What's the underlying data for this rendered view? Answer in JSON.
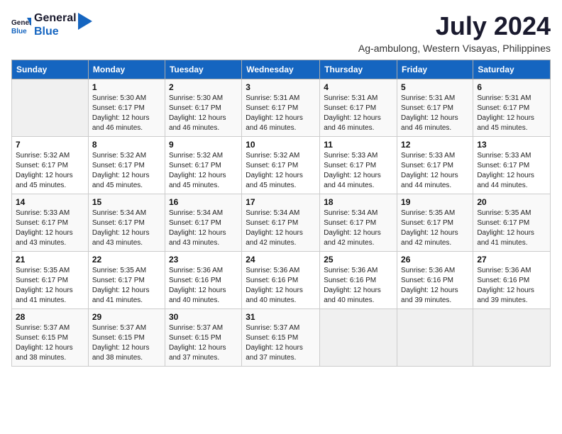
{
  "header": {
    "logo_line1": "General",
    "logo_line2": "Blue",
    "month": "July 2024",
    "location": "Ag-ambulong, Western Visayas, Philippines"
  },
  "days_of_week": [
    "Sunday",
    "Monday",
    "Tuesday",
    "Wednesday",
    "Thursday",
    "Friday",
    "Saturday"
  ],
  "weeks": [
    [
      {
        "day": "",
        "sunrise": "",
        "sunset": "",
        "daylight": ""
      },
      {
        "day": "1",
        "sunrise": "Sunrise: 5:30 AM",
        "sunset": "Sunset: 6:17 PM",
        "daylight": "Daylight: 12 hours and 46 minutes."
      },
      {
        "day": "2",
        "sunrise": "Sunrise: 5:30 AM",
        "sunset": "Sunset: 6:17 PM",
        "daylight": "Daylight: 12 hours and 46 minutes."
      },
      {
        "day": "3",
        "sunrise": "Sunrise: 5:31 AM",
        "sunset": "Sunset: 6:17 PM",
        "daylight": "Daylight: 12 hours and 46 minutes."
      },
      {
        "day": "4",
        "sunrise": "Sunrise: 5:31 AM",
        "sunset": "Sunset: 6:17 PM",
        "daylight": "Daylight: 12 hours and 46 minutes."
      },
      {
        "day": "5",
        "sunrise": "Sunrise: 5:31 AM",
        "sunset": "Sunset: 6:17 PM",
        "daylight": "Daylight: 12 hours and 46 minutes."
      },
      {
        "day": "6",
        "sunrise": "Sunrise: 5:31 AM",
        "sunset": "Sunset: 6:17 PM",
        "daylight": "Daylight: 12 hours and 45 minutes."
      }
    ],
    [
      {
        "day": "7",
        "sunrise": "Sunrise: 5:32 AM",
        "sunset": "Sunset: 6:17 PM",
        "daylight": "Daylight: 12 hours and 45 minutes."
      },
      {
        "day": "8",
        "sunrise": "Sunrise: 5:32 AM",
        "sunset": "Sunset: 6:17 PM",
        "daylight": "Daylight: 12 hours and 45 minutes."
      },
      {
        "day": "9",
        "sunrise": "Sunrise: 5:32 AM",
        "sunset": "Sunset: 6:17 PM",
        "daylight": "Daylight: 12 hours and 45 minutes."
      },
      {
        "day": "10",
        "sunrise": "Sunrise: 5:32 AM",
        "sunset": "Sunset: 6:17 PM",
        "daylight": "Daylight: 12 hours and 45 minutes."
      },
      {
        "day": "11",
        "sunrise": "Sunrise: 5:33 AM",
        "sunset": "Sunset: 6:17 PM",
        "daylight": "Daylight: 12 hours and 44 minutes."
      },
      {
        "day": "12",
        "sunrise": "Sunrise: 5:33 AM",
        "sunset": "Sunset: 6:17 PM",
        "daylight": "Daylight: 12 hours and 44 minutes."
      },
      {
        "day": "13",
        "sunrise": "Sunrise: 5:33 AM",
        "sunset": "Sunset: 6:17 PM",
        "daylight": "Daylight: 12 hours and 44 minutes."
      }
    ],
    [
      {
        "day": "14",
        "sunrise": "Sunrise: 5:33 AM",
        "sunset": "Sunset: 6:17 PM",
        "daylight": "Daylight: 12 hours and 43 minutes."
      },
      {
        "day": "15",
        "sunrise": "Sunrise: 5:34 AM",
        "sunset": "Sunset: 6:17 PM",
        "daylight": "Daylight: 12 hours and 43 minutes."
      },
      {
        "day": "16",
        "sunrise": "Sunrise: 5:34 AM",
        "sunset": "Sunset: 6:17 PM",
        "daylight": "Daylight: 12 hours and 43 minutes."
      },
      {
        "day": "17",
        "sunrise": "Sunrise: 5:34 AM",
        "sunset": "Sunset: 6:17 PM",
        "daylight": "Daylight: 12 hours and 42 minutes."
      },
      {
        "day": "18",
        "sunrise": "Sunrise: 5:34 AM",
        "sunset": "Sunset: 6:17 PM",
        "daylight": "Daylight: 12 hours and 42 minutes."
      },
      {
        "day": "19",
        "sunrise": "Sunrise: 5:35 AM",
        "sunset": "Sunset: 6:17 PM",
        "daylight": "Daylight: 12 hours and 42 minutes."
      },
      {
        "day": "20",
        "sunrise": "Sunrise: 5:35 AM",
        "sunset": "Sunset: 6:17 PM",
        "daylight": "Daylight: 12 hours and 41 minutes."
      }
    ],
    [
      {
        "day": "21",
        "sunrise": "Sunrise: 5:35 AM",
        "sunset": "Sunset: 6:17 PM",
        "daylight": "Daylight: 12 hours and 41 minutes."
      },
      {
        "day": "22",
        "sunrise": "Sunrise: 5:35 AM",
        "sunset": "Sunset: 6:17 PM",
        "daylight": "Daylight: 12 hours and 41 minutes."
      },
      {
        "day": "23",
        "sunrise": "Sunrise: 5:36 AM",
        "sunset": "Sunset: 6:16 PM",
        "daylight": "Daylight: 12 hours and 40 minutes."
      },
      {
        "day": "24",
        "sunrise": "Sunrise: 5:36 AM",
        "sunset": "Sunset: 6:16 PM",
        "daylight": "Daylight: 12 hours and 40 minutes."
      },
      {
        "day": "25",
        "sunrise": "Sunrise: 5:36 AM",
        "sunset": "Sunset: 6:16 PM",
        "daylight": "Daylight: 12 hours and 40 minutes."
      },
      {
        "day": "26",
        "sunrise": "Sunrise: 5:36 AM",
        "sunset": "Sunset: 6:16 PM",
        "daylight": "Daylight: 12 hours and 39 minutes."
      },
      {
        "day": "27",
        "sunrise": "Sunrise: 5:36 AM",
        "sunset": "Sunset: 6:16 PM",
        "daylight": "Daylight: 12 hours and 39 minutes."
      }
    ],
    [
      {
        "day": "28",
        "sunrise": "Sunrise: 5:37 AM",
        "sunset": "Sunset: 6:15 PM",
        "daylight": "Daylight: 12 hours and 38 minutes."
      },
      {
        "day": "29",
        "sunrise": "Sunrise: 5:37 AM",
        "sunset": "Sunset: 6:15 PM",
        "daylight": "Daylight: 12 hours and 38 minutes."
      },
      {
        "day": "30",
        "sunrise": "Sunrise: 5:37 AM",
        "sunset": "Sunset: 6:15 PM",
        "daylight": "Daylight: 12 hours and 37 minutes."
      },
      {
        "day": "31",
        "sunrise": "Sunrise: 5:37 AM",
        "sunset": "Sunset: 6:15 PM",
        "daylight": "Daylight: 12 hours and 37 minutes."
      },
      {
        "day": "",
        "sunrise": "",
        "sunset": "",
        "daylight": ""
      },
      {
        "day": "",
        "sunrise": "",
        "sunset": "",
        "daylight": ""
      },
      {
        "day": "",
        "sunrise": "",
        "sunset": "",
        "daylight": ""
      }
    ]
  ]
}
